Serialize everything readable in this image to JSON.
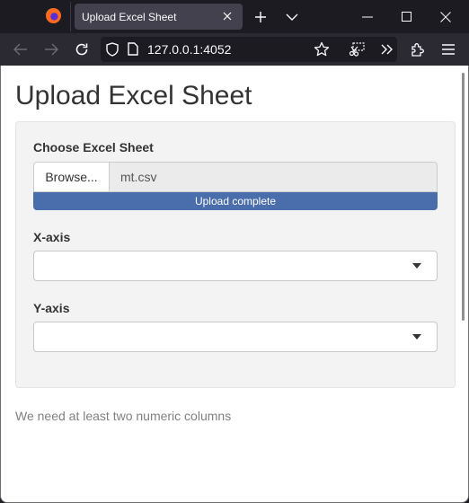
{
  "browser": {
    "tab_title": "Upload Excel Sheet",
    "url": "127.0.0.1:4052",
    "icons": {
      "app_logo": "firefox-logo",
      "tab_close": "close-icon",
      "new_tab": "plus-icon",
      "tab_list": "chevron-down-icon",
      "minimize": "minimize-icon",
      "maximize": "maximize-icon",
      "close_window": "close-icon",
      "back": "arrow-left-icon",
      "forward": "arrow-right-icon",
      "reload": "reload-icon",
      "tracking": "shield-icon",
      "page": "page-icon",
      "bookmark": "star-icon",
      "screenshot": "screenshot-icon",
      "overflow": "chevrons-right-icon",
      "extensions": "puzzle-icon",
      "menu": "hamburger-icon"
    }
  },
  "page": {
    "title": "Upload Excel Sheet",
    "file_input": {
      "label": "Choose Excel Sheet",
      "button_label": "Browse...",
      "file_name": "mt.csv",
      "progress_text": "Upload complete",
      "progress_percent": 100
    },
    "x_axis": {
      "label": "X-axis",
      "value": ""
    },
    "y_axis": {
      "label": "Y-axis",
      "value": ""
    },
    "message": "We need at least two numeric columns"
  },
  "colors": {
    "progress_bar": "#4a6eab",
    "browser_chrome": "#1c1b22",
    "toolbar": "#2b2a33"
  }
}
